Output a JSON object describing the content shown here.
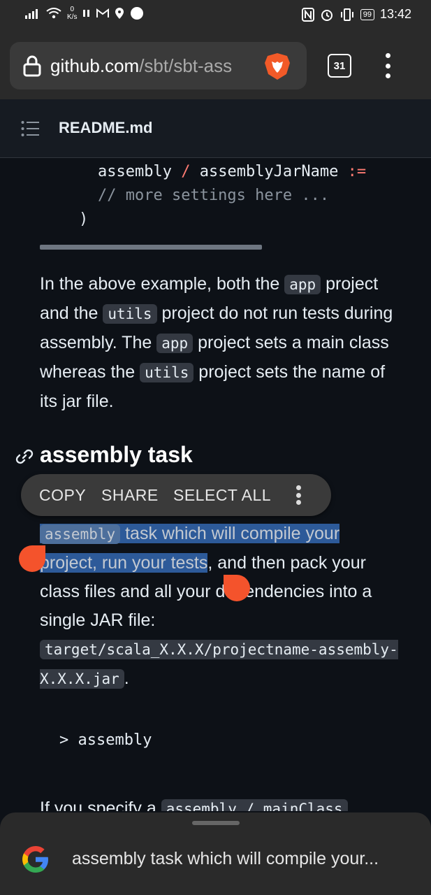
{
  "status_bar": {
    "net_speed_value": "0",
    "net_speed_unit": "K/s",
    "battery": "99",
    "time": "13:42"
  },
  "browser": {
    "url_host": "github.com",
    "url_path": "/sbt/sbt-ass",
    "tab_count": "31"
  },
  "readme": {
    "title": "README.md"
  },
  "code_top": {
    "line1_a": "assembly",
    "line1_op1": "/",
    "line1_b": "assemblyJarName",
    "line1_op2": ":=",
    "line2": "// more settings here ...",
    "line3": ")"
  },
  "paragraph1": {
    "t1": "In the above example, both the ",
    "c1": "app",
    "t2": " project and the ",
    "c2": "utils",
    "t3": " project do not run tests during assembly. The ",
    "c3": "app",
    "t4": " project sets a main class whereas the ",
    "c4": "utils",
    "t5": " project sets the name of its jar file."
  },
  "section": {
    "heading": "assembly task"
  },
  "selection_toolbar": {
    "copy": "COPY",
    "share": "SHARE",
    "select_all": "SELECT ALL"
  },
  "paragraph2": {
    "c1": "assembly",
    "sel_text": " task which will compile your project, run your tests",
    "t1": ", and then pack your class files and all your dependencies into a single JAR file: ",
    "c2": "target/scala_X.X.X/projectname-assembly-X.X.X.jar",
    "t2": "."
  },
  "command": {
    "text": "> assembly"
  },
  "paragraph3": {
    "t1": "If you specify a ",
    "c1": "assembly / mainClass"
  },
  "google_bar": {
    "query": "assembly task which will compile your..."
  },
  "colors": {
    "background": "#0d1117",
    "selection": "#2d5a99",
    "handle": "#f4532c"
  }
}
